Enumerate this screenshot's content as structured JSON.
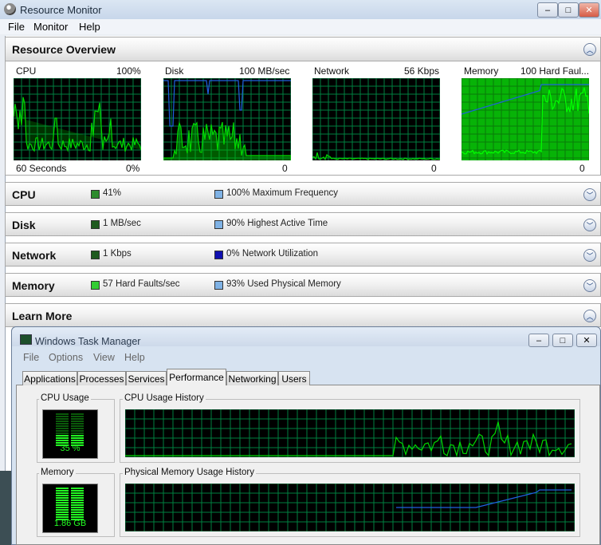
{
  "window": {
    "title": "Resource Monitor",
    "controls": [
      "–",
      "□",
      "✕"
    ]
  },
  "menu": [
    "File",
    "Monitor",
    "Help"
  ],
  "overview": {
    "title": "Resource Overview",
    "graphs": [
      {
        "label": "CPU",
        "max": "100%",
        "footer_left": "60 Seconds",
        "footer_right": "0%"
      },
      {
        "label": "Disk",
        "max": "100 MB/sec",
        "footer_right": "0"
      },
      {
        "label": "Network",
        "max": "56 Kbps",
        "footer_right": "0"
      },
      {
        "label": "Memory",
        "max": "100 Hard Faul...",
        "footer_right": "0"
      }
    ]
  },
  "sections": [
    {
      "title": "CPU",
      "metric1": "41%",
      "metric2": "100% Maximum Frequency",
      "color1": "#2e8b2e",
      "color2": "#7fb2e5"
    },
    {
      "title": "Disk",
      "metric1": "1 MB/sec",
      "metric2": "90% Highest Active Time",
      "color1": "#1f5a1f",
      "color2": "#7fb2e5"
    },
    {
      "title": "Network",
      "metric1": "1 Kbps",
      "metric2": "0% Network Utilization",
      "color1": "#1f5a1f",
      "color2": "#1010b0"
    },
    {
      "title": "Memory",
      "metric1": "57 Hard Faults/sec",
      "metric2": "93% Used Physical Memory",
      "color1": "#33cc33",
      "color2": "#7fb2e5"
    },
    {
      "title": "Learn More"
    }
  ],
  "task_manager": {
    "title": "Windows Task Manager",
    "menu": [
      "File",
      "Options",
      "View",
      "Help"
    ],
    "tabs": [
      "Applications",
      "Processes",
      "Services",
      "Performance",
      "Networking",
      "Users"
    ],
    "active_tab": "Performance",
    "cpu_usage": {
      "label": "CPU Usage",
      "value": "35 %",
      "level": 0.35
    },
    "cpu_history": {
      "label": "CPU Usage History"
    },
    "memory": {
      "label": "Memory",
      "value": "1.86 GB"
    },
    "memory_history": {
      "label": "Physical Memory Usage History"
    }
  },
  "colors": {
    "graph_green": "#00d800",
    "grid": "#008040",
    "blue_line": "#2060e0"
  }
}
